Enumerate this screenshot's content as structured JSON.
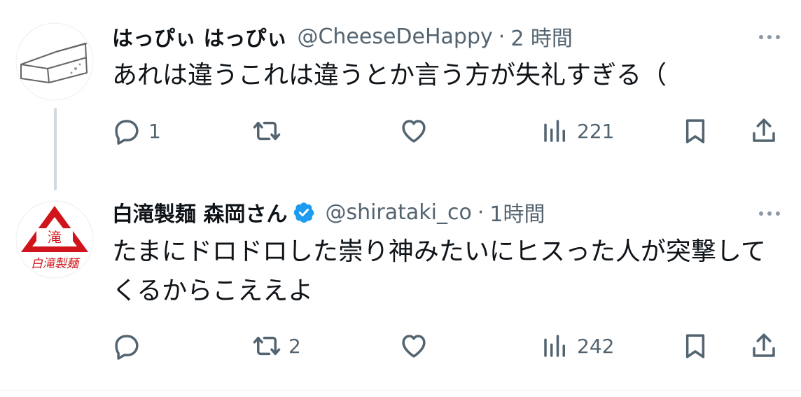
{
  "tweets": [
    {
      "name": "はっぴぃ はっぴぃ",
      "handle": "@CheeseDeHappy",
      "separator": "·",
      "time": "2 時間",
      "text": "あれは違うこれは違うとか言う方が失礼すぎる（",
      "verified": false,
      "avatar_icon": "cheese-icon",
      "reply_count": "1",
      "retweet_count": "",
      "like_count": "",
      "view_count": "221"
    },
    {
      "name": "白滝製麺 森岡さん",
      "handle": "@shirataki_co",
      "separator": "·",
      "time": "1時間",
      "text": "たまにドロドロした崇り神みたいにヒスった人が突撃してくるからこええよ",
      "verified": true,
      "avatar_icon": "shirataki-logo",
      "avatar_logo_text": "滝",
      "avatar_logo_caption": "白滝製麺",
      "reply_count": "",
      "retweet_count": "2",
      "like_count": "",
      "view_count": "242"
    }
  ],
  "colors": {
    "text": "#0f1419",
    "secondary": "#536471",
    "verified": "#1d9bf0",
    "logo_red": "#d0141b",
    "thread_line": "#cfd9de"
  }
}
